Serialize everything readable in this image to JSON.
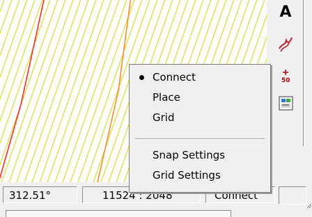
{
  "canvas": {
    "hatch_color": "#d6e02a",
    "line_red_color": "#ff2a2a",
    "line_orange_color": "#ff8a2a"
  },
  "toolbar": {
    "tools": [
      "text-tool-icon",
      "draw-tool-icon",
      "snap-tool-icon",
      "view-tool-icon"
    ],
    "text_tool_label": "A",
    "snap_sub_label": "50"
  },
  "context_menu": {
    "items": [
      {
        "label": "Connect",
        "checked": true
      },
      {
        "label": "Place",
        "checked": false
      },
      {
        "label": "Grid",
        "checked": false
      },
      {
        "label": "Snap Settings",
        "checked": false
      },
      {
        "label": "Grid Settings",
        "checked": false
      }
    ]
  },
  "statusbar": {
    "angle": "312.51°",
    "coords": "11524 : 2048",
    "mode": "Connect",
    "extra": ""
  }
}
